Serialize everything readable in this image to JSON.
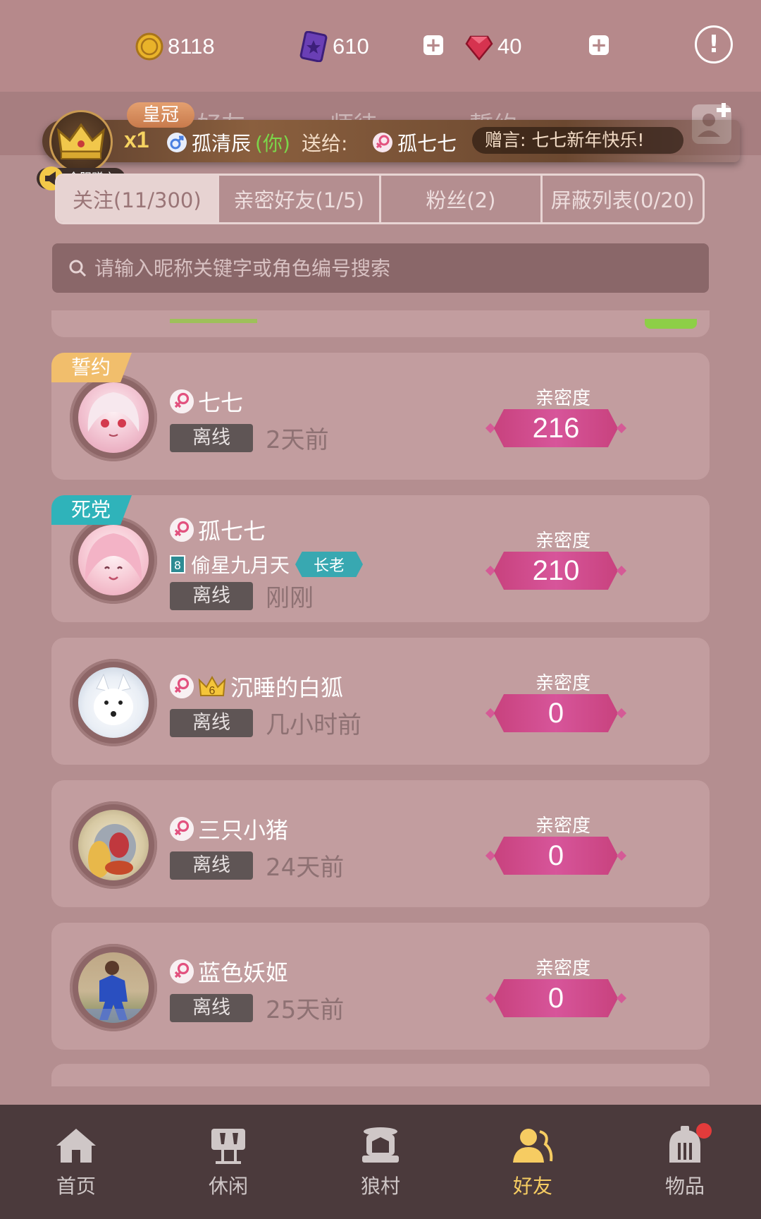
{
  "currency": {
    "coins": "8118",
    "cards": "610",
    "gems": "40"
  },
  "nav_tabs": [
    "好友",
    "师徒",
    "誓约"
  ],
  "gift_banner": {
    "crown_label": "皇冠",
    "count": "x1",
    "sender": "孤清辰",
    "you_label": "(你)",
    "send_to": "送给:",
    "receiver": "孤七七",
    "message": "赠言: 七七新年快乐!",
    "all_server": "全服赠言"
  },
  "segments": [
    "关注(11/300)",
    "亲密好友(1/5)",
    "粉丝(2)",
    "屏蔽列表(0/20)"
  ],
  "search": {
    "placeholder": "请输入昵称关键字或角色编号搜索"
  },
  "friends": [
    {
      "tag": "誓约",
      "name": "七七",
      "status": "离线",
      "ago": "2天前",
      "intimacy_label": "亲密度",
      "intimacy": "216"
    },
    {
      "tag": "死党",
      "name": "孤七七",
      "title": "偷星九月天",
      "title_level": "8",
      "role": "长老",
      "status": "离线",
      "ago": "刚刚",
      "intimacy_label": "亲密度",
      "intimacy": "210"
    },
    {
      "name": "沉睡的白狐",
      "vip_level": "6",
      "status": "离线",
      "ago": "几小时前",
      "intimacy_label": "亲密度",
      "intimacy": "0"
    },
    {
      "name": "三只小猪",
      "status": "离线",
      "ago": "24天前",
      "intimacy_label": "亲密度",
      "intimacy": "0"
    },
    {
      "name": "蓝色妖姬",
      "status": "离线",
      "ago": "25天前",
      "intimacy_label": "亲密度",
      "intimacy": "0"
    }
  ],
  "bottom_nav": [
    {
      "label": "首页",
      "icon": "home-icon"
    },
    {
      "label": "休闲",
      "icon": "leisure-icon"
    },
    {
      "label": "狼村",
      "icon": "wolf-village-icon"
    },
    {
      "label": "好友",
      "icon": "friends-icon",
      "active": true
    },
    {
      "label": "物品",
      "icon": "items-icon",
      "badge": true
    }
  ],
  "colors": {
    "background": "#b48e90",
    "card": "#c29d9f",
    "intimacy_pink": "#d7559a",
    "active_nav": "#f6cc62",
    "you_green": "#7bd64a"
  }
}
